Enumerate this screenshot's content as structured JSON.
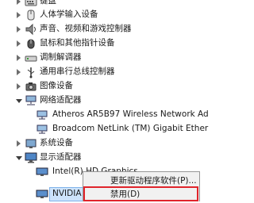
{
  "tree": {
    "items": [
      {
        "label": "键盘",
        "expanded": false
      },
      {
        "label": "人体学输入设备",
        "expanded": false
      },
      {
        "label": "声音、视频和游戏控制器",
        "expanded": false
      },
      {
        "label": "鼠标和其他指针设备",
        "expanded": false
      },
      {
        "label": "调制解调器",
        "expanded": false
      },
      {
        "label": "通用串行总线控制器",
        "expanded": false
      },
      {
        "label": "图像设备",
        "expanded": false
      },
      {
        "label": "网络适配器",
        "expanded": true
      },
      {
        "label": "Atheros AR5B97 Wireless Network Ad"
      },
      {
        "label": "Broadcom NetLink (TM) Gigabit Ether"
      },
      {
        "label": "系统设备",
        "expanded": false
      },
      {
        "label": "显示适配器",
        "expanded": true
      },
      {
        "label": "Intel(R) HD Graphics"
      },
      {
        "label": "NVIDIA G"
      }
    ]
  },
  "context_menu": {
    "items": [
      {
        "label": "更新驱动程序软件(P)..."
      },
      {
        "label": "禁用(D)"
      }
    ]
  },
  "colors": {
    "selection": "#cde3fb",
    "highlight_border": "#e0242b",
    "menu_bg": "#f1f1f1"
  }
}
